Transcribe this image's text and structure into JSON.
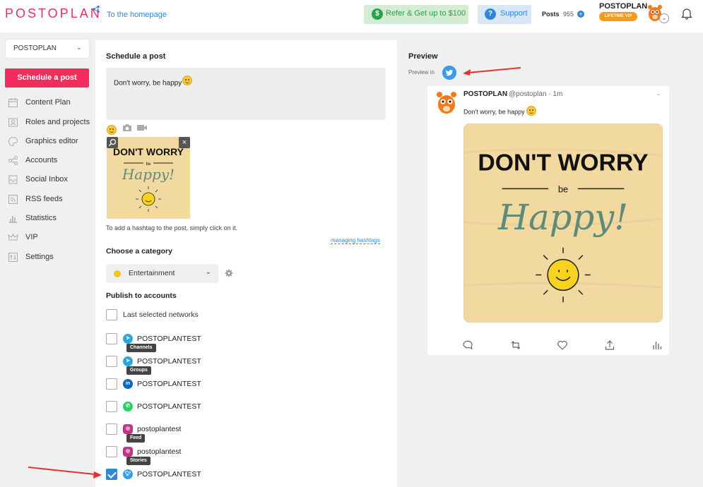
{
  "header": {
    "logo": "POSTOPLAN",
    "home_link": "To the homepage",
    "refer_label": "Refer & Get up to $100",
    "refer_icon": "$",
    "support_label": "Support",
    "support_icon": "?",
    "posts_label": "Posts",
    "posts_count": "955",
    "user_name": "POSTOPLAN",
    "user_badge": "LIFETIME VIP"
  },
  "sidebar": {
    "project": "POSTOPLAN",
    "schedule_button": "Schedule a post",
    "items": [
      {
        "label": "Content Plan",
        "icon": "calendar-icon"
      },
      {
        "label": "Roles and projects",
        "icon": "users-icon"
      },
      {
        "label": "Graphics editor",
        "icon": "palette-icon"
      },
      {
        "label": "Accounts",
        "icon": "share-icon"
      },
      {
        "label": "Social Inbox",
        "icon": "inbox-icon"
      },
      {
        "label": "RSS feeds",
        "icon": "rss-icon"
      },
      {
        "label": "Statistics",
        "icon": "bar-chart-icon"
      },
      {
        "label": "VIP",
        "icon": "crown-icon"
      },
      {
        "label": "Settings",
        "icon": "settings-icon"
      }
    ]
  },
  "editor": {
    "title": "Schedule a post",
    "post_text": "Don't worry, be happy",
    "hashtag_hint": "To add a hashtag to the post, simply click on it.",
    "hashtag_link": "managing hashtags",
    "category_title": "Choose a category",
    "category_value": "Entertainment",
    "category_color": "#f5c518",
    "publish_title": "Publish to accounts",
    "last_networks": "Last selected networks",
    "accounts": [
      {
        "name": "POSTOPLANTEST",
        "network": "telegram",
        "tag": "Channels",
        "checked": false
      },
      {
        "name": "POSTOPLANTEST",
        "network": "telegram",
        "tag": "Groups",
        "checked": false
      },
      {
        "name": "POSTOPLANTEST",
        "network": "linkedin",
        "tag": "",
        "checked": false
      },
      {
        "name": "POSTOPLANTEST",
        "network": "whatsapp",
        "tag": "",
        "checked": false
      },
      {
        "name": "postoplantest",
        "network": "instagram",
        "tag": "Feed",
        "checked": false
      },
      {
        "name": "postoplantest",
        "network": "instagram",
        "tag": "Stories",
        "checked": false
      },
      {
        "name": "POSTOPLANTEST",
        "network": "twitter",
        "tag": "",
        "checked": true
      }
    ]
  },
  "attachment": {
    "line1": "DON'T WORRY",
    "line2": "be",
    "line3": "Happy!"
  },
  "preview": {
    "title": "Preview",
    "preview_in": "Preview in",
    "name": "POSTOPLAN",
    "handle": "@postoplan · 1m",
    "text": "Don't worry, be happy"
  },
  "colors": {
    "brand": "#e8305a",
    "primary_button": "#f22c5c",
    "link": "#2f86d3",
    "twitter": "#3b9de7"
  }
}
